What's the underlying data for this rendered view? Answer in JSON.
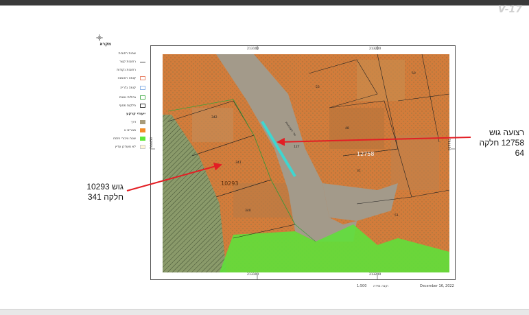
{
  "header": {
    "logo": "V-17"
  },
  "legend": {
    "title": "מקרא",
    "items": [
      {
        "label": "שמות רחובות",
        "kind": "text"
      },
      {
        "label": "רחובות קשר",
        "kind": "line",
        "color": "#444444"
      },
      {
        "label": "רחובות נקודות",
        "kind": "text"
      },
      {
        "label": "קומה ראשונה",
        "kind": "box",
        "color": "#e8866b"
      },
      {
        "label": "קומה גלריה",
        "kind": "box",
        "color": "#8fb6e8"
      },
      {
        "label": "גבולות גושים",
        "kind": "box",
        "color": "#4caf50"
      },
      {
        "label": "חלקות מסוף",
        "kind": "box",
        "color": "#333333"
      }
    ],
    "zoning_title": "ייעודי קרקע",
    "zoning": [
      {
        "label": "דרך",
        "color": "#a89b7a"
      },
      {
        "label": "מגורים א",
        "color": "#f28c28"
      },
      {
        "label": "שטח ציבורי פתוח",
        "color": "#5ee83a"
      },
      {
        "label": "לא מעודכן עדיין",
        "color": "#fff6d6"
      }
    ]
  },
  "map": {
    "grid_top": [
      "213100",
      "213200"
    ],
    "grid_bottom": [
      "213100",
      "213200"
    ],
    "grid_left": "744450",
    "grid_right": "744450",
    "block_labels": [
      "10293",
      "12758"
    ],
    "parcels": [
      "342",
      "341",
      "340",
      "127",
      "48",
      "31",
      "53",
      "50",
      "51"
    ],
    "road_label": "שד' העצמאות"
  },
  "annotations": {
    "left": {
      "line1": "גוש 10293",
      "line2": "חלקה 341"
    },
    "right": {
      "line1": "רצועה גוש",
      "line2": "12758 חלקה",
      "line3": "64"
    }
  },
  "footer": {
    "scale_label": "קנה מידה:",
    "scale": "1:500",
    "date": "December 16, 2022"
  },
  "colors": {
    "arrow": "#e31e24",
    "strip": "#3fd6d0",
    "green_zone": "#5fe03b",
    "orange_zone": "#d9823a"
  }
}
